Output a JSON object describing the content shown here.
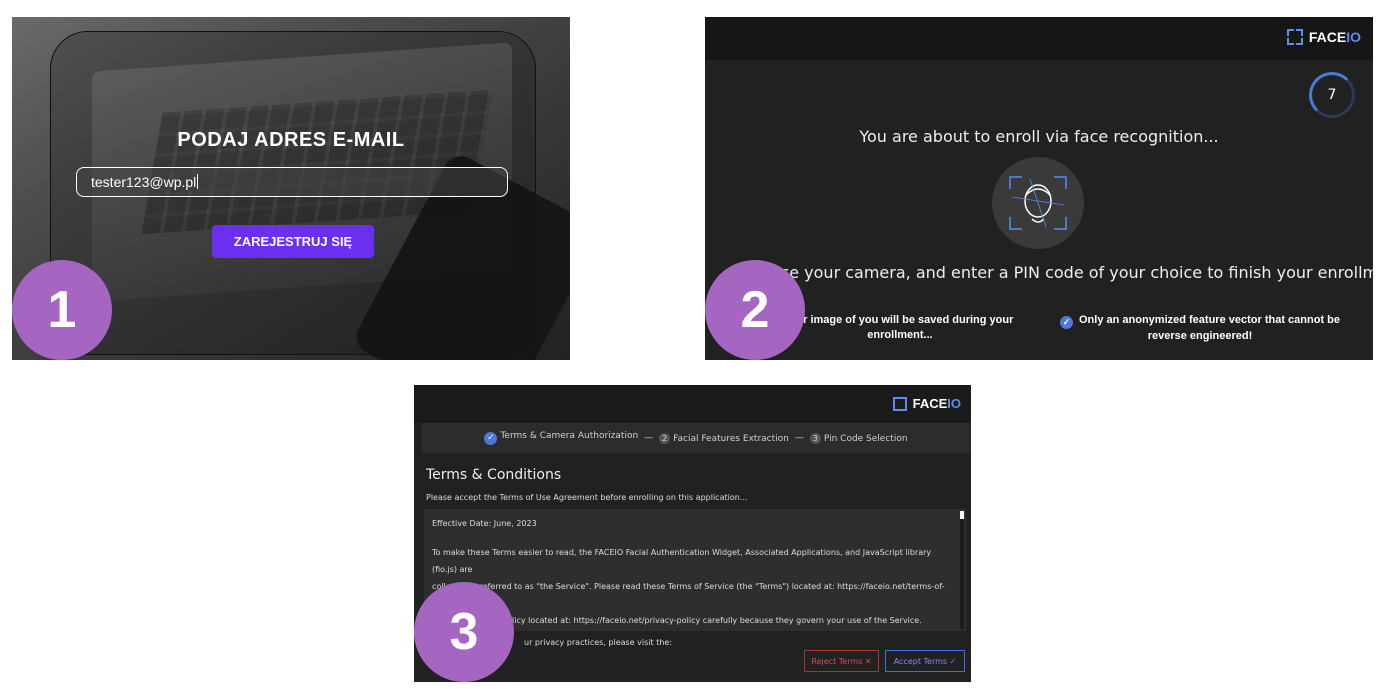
{
  "panel1": {
    "title": "PODAJ ADRES E-MAIL",
    "email_value": "tester123@wp.pl",
    "register_button": "ZAREJESTRUJ SIĘ"
  },
  "panel2": {
    "logo": {
      "face": "FACE",
      "io": "IO"
    },
    "countdown": "7",
    "heading": "You are about to enroll via face recognition...",
    "instruction": "face your camera, and enter a PIN code of your choice to finish your enrollment...",
    "note1": "o or image of you will be saved during your enrollment...",
    "note2": "Only an anonymized feature vector that cannot be reverse engineered!"
  },
  "panel3": {
    "logo": {
      "face": "FACE",
      "io": "IO"
    },
    "steps": [
      {
        "label": "Terms & Camera Authorization"
      },
      {
        "num": "2",
        "label": "Facial Features Extraction"
      },
      {
        "num": "3",
        "label": "Pin Code Selection"
      }
    ],
    "title": "Terms & Conditions",
    "description": "Please accept the Terms of Use Agreement before enrolling on this application...",
    "effective_date": "Effective Date: June, 2023",
    "body_line1": "To make these Terms easier to read, the FACEIO Facial Authentication Widget, Associated Applications, and JavaScript library (fio.js) are",
    "body_line2": "collectively referred to as \"the Service\". Please read these Terms of Service (the \"Terms\") located at: https://faceio.net/terms-of-use and",
    "body_line3": "licy located at: https://faceio.net/privacy-policy carefully because they govern your use of the Service.",
    "privacy_line": "ur privacy practices, please visit the:",
    "reject_button": "Reject Terms ✕",
    "accept_button": "Accept Terms ✓"
  },
  "badges": [
    "1",
    "2",
    "3"
  ],
  "colors": {
    "accent_purple": "#6b2ff0",
    "badge": "#a466c0",
    "faceio_blue": "#5b8df0"
  }
}
